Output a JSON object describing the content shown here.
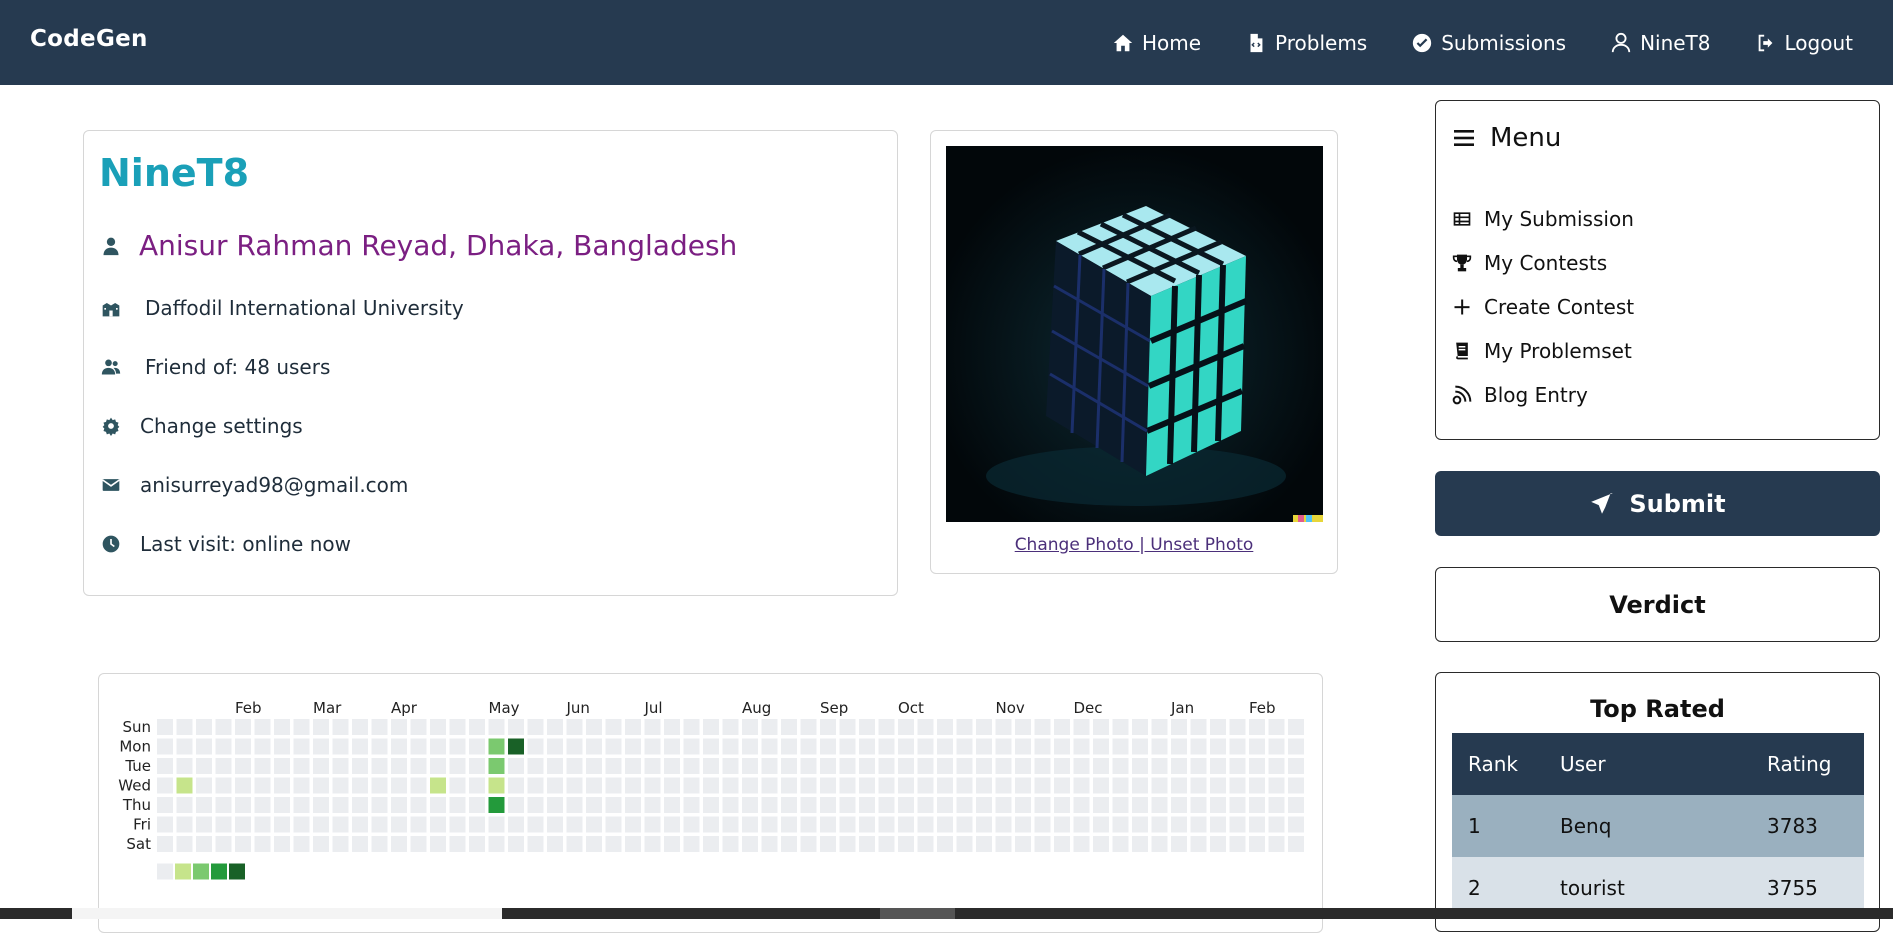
{
  "navbar": {
    "brand": "CodeGen",
    "links": [
      {
        "label": "Home",
        "icon": "home-icon"
      },
      {
        "label": "Problems",
        "icon": "file-code-icon"
      },
      {
        "label": "Submissions",
        "icon": "check-circle-icon"
      },
      {
        "label": "NineT8",
        "icon": "user-icon"
      },
      {
        "label": "Logout",
        "icon": "logout-icon"
      }
    ]
  },
  "profile": {
    "handle": "NineT8",
    "name": "Anisur Rahman Reyad, Dhaka, Bangladesh",
    "university": "Daffodil International University",
    "friends": "Friend of: 48 users",
    "settings": "Change settings",
    "email": "anisurreyad98@gmail.com",
    "last_visit": "Last visit: online now"
  },
  "photo": {
    "links": "Change Photo | Unset Photo"
  },
  "menu": {
    "title": "Menu",
    "items": [
      {
        "label": "My Submission",
        "icon": "table-icon"
      },
      {
        "label": "My Contests",
        "icon": "trophy-icon"
      },
      {
        "label": "Create Contest",
        "icon": "plus-icon"
      },
      {
        "label": "My Problemset",
        "icon": "book-icon"
      },
      {
        "label": "Blog Entry",
        "icon": "blog-icon"
      }
    ]
  },
  "submit": {
    "label": "Submit"
  },
  "verdict": {
    "label": "Verdict"
  },
  "top_rated": {
    "title": "Top Rated",
    "headers": [
      "Rank",
      "User",
      "Rating"
    ],
    "rows": [
      [
        "1",
        "Benq",
        "3783"
      ],
      [
        "2",
        "tourist",
        "3755"
      ]
    ]
  },
  "heatmap": {
    "months": [
      "Feb",
      "Mar",
      "Apr",
      "May",
      "Jun",
      "Jul",
      "Aug",
      "Sep",
      "Oct",
      "Nov",
      "Dec",
      "Jan",
      "Feb"
    ],
    "month_start_weeks": [
      4,
      8,
      12,
      17,
      21,
      25,
      30,
      34,
      38,
      43,
      47,
      52,
      56
    ],
    "days": [
      "Sun",
      "Mon",
      "Tue",
      "Wed",
      "Thu",
      "Fri",
      "Sat"
    ],
    "weeks": 59,
    "colors": {
      "empty": "#ebedf0",
      "l1": "#c6e48b",
      "l2": "#7bc96f",
      "l3": "#239a3b",
      "l4": "#196127"
    },
    "activity": [
      {
        "week": 1,
        "day": 3,
        "level": 1
      },
      {
        "week": 14,
        "day": 3,
        "level": 1
      },
      {
        "week": 17,
        "day": 1,
        "level": 2
      },
      {
        "week": 18,
        "day": 1,
        "level": 4
      },
      {
        "week": 17,
        "day": 2,
        "level": 2
      },
      {
        "week": 17,
        "day": 3,
        "level": 1
      },
      {
        "week": 17,
        "day": 4,
        "level": 3
      }
    ],
    "legend_levels": [
      "empty",
      "l1",
      "l2",
      "l3",
      "l4"
    ]
  }
}
